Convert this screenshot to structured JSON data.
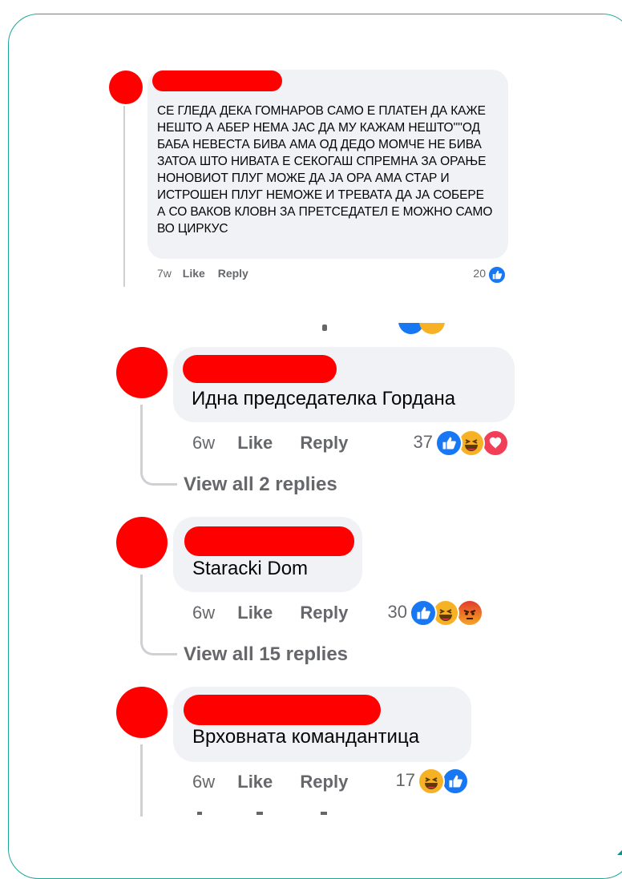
{
  "comments": [
    {
      "text": "СЕ ГЛЕДА ДЕКА ГОМНАРОВ САМО Е ПЛАТЕН ДА КАЖЕ НЕШТО А АБЕР НЕМА ЈАС ДА МУ КАЖАМ НЕШТО''''ОД БАБА НЕВЕСТА БИВА АМА ОД ДЕДО МОМЧЕ НЕ БИВА ЗАТОА ШТО НИВАТА Е СЕКОГАШ СПРЕМНА ЗА ОРАЊЕ НОНОВИОТ ПЛУГ МОЖЕ ДА ЈА ОРА АМА СТАР И ИСТРОШЕН ПЛУГ НЕМОЖЕ И ТРЕВАТА ДА ЈА СОБЕРЕ А СО ВАКОВ КЛОВН ЗА ПРЕТСЕДАТЕЛ Е МОЖНО САМО ВО ЦИРКУС",
      "time": "7w",
      "like": "Like",
      "reply": "Reply",
      "reaction_count": "20",
      "reactions": [
        "like-icon"
      ]
    },
    {
      "text": "Идна председателка Гордана",
      "time": "6w",
      "like": "Like",
      "reply": "Reply",
      "reaction_count": "37",
      "reactions": [
        "like-icon",
        "haha-icon",
        "love-icon"
      ],
      "view_replies": "View all 2 replies"
    },
    {
      "text": "Staracki Dom",
      "time": "6w",
      "like": "Like",
      "reply": "Reply",
      "reaction_count": "30",
      "reactions": [
        "like-icon",
        "haha-icon",
        "angry-icon"
      ],
      "view_replies": "View all 15 replies"
    },
    {
      "text": "Врховната командантица",
      "time": "6w",
      "like": "Like",
      "reply": "Reply",
      "reaction_count": "17",
      "reactions": [
        "haha-icon",
        "like-icon"
      ]
    }
  ],
  "colors": {
    "redaction": "#ff0000",
    "bubble": "#f0f2f5",
    "meta_text": "#65676b",
    "like_blue": "#1877f2",
    "frame": "#1aa79a"
  }
}
